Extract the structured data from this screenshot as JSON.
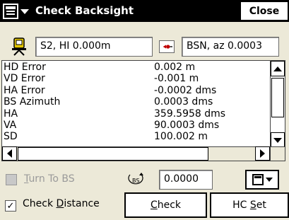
{
  "titlebar": {
    "title": "Check Backsight",
    "close_label": "Close"
  },
  "station": {
    "value": "S2, HI 0.000m"
  },
  "backsight": {
    "value": "BSN, az 0.0003"
  },
  "results": {
    "rows": [
      {
        "key": "HD Error",
        "value": "0.002 m"
      },
      {
        "key": "VD Error",
        "value": "-0.001 m"
      },
      {
        "key": "HA Error",
        "value": "-0.0002 dms"
      },
      {
        "key": "BS Azimuth",
        "value": "0.0003 dms"
      },
      {
        "key": "HA",
        "value": "359.5958 dms"
      },
      {
        "key": "VA",
        "value": "90.0003 dms"
      },
      {
        "key": "SD",
        "value": "100.002 m"
      }
    ]
  },
  "turn_to_bs": {
    "label_pre": "",
    "label_ul": "T",
    "label_post": "urn To BS",
    "checked": false,
    "enabled": false
  },
  "bs_icon_label": "BS",
  "angle": {
    "value": "0.0000"
  },
  "check_distance": {
    "label_pre": "Check ",
    "label_ul": "D",
    "label_post": "istance",
    "checked": true,
    "mark": "✓"
  },
  "buttons": {
    "check": {
      "pre": "",
      "ul": "C",
      "post": "heck"
    },
    "hcset": {
      "pre": "HC ",
      "ul": "S",
      "post": "et"
    }
  },
  "colors": {
    "window_bg": "#ece9d8",
    "titlebar_bg": "#000000",
    "station_icon": "#e5c800"
  }
}
